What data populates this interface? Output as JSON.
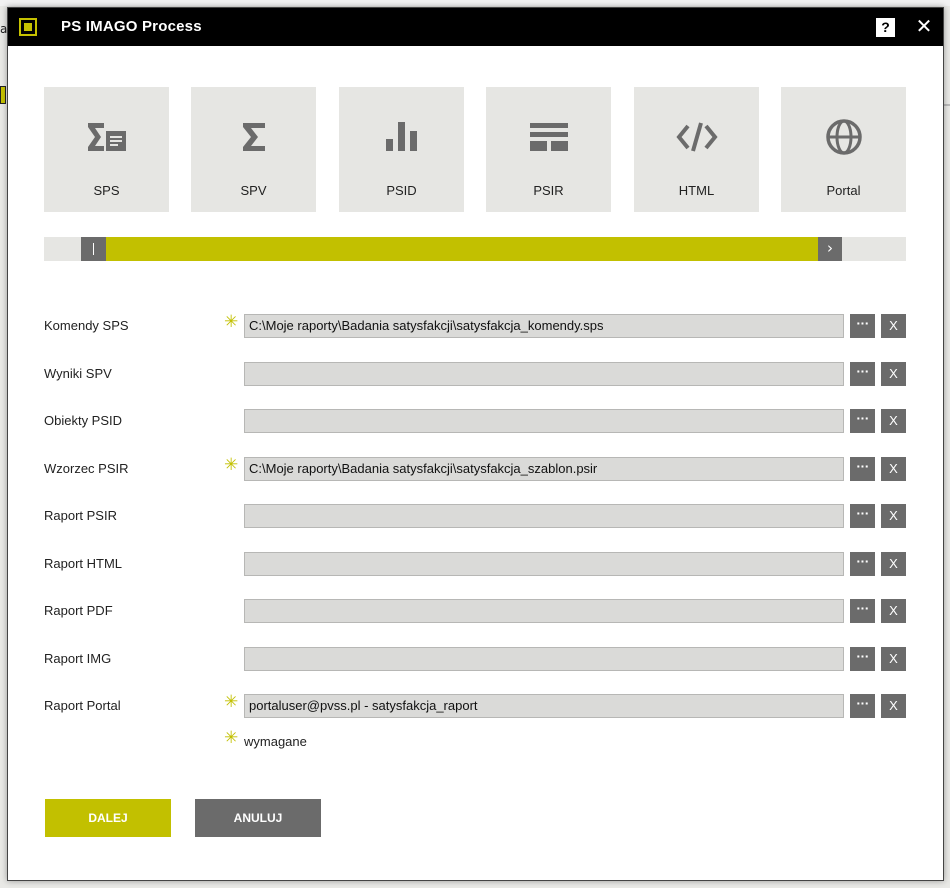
{
  "window": {
    "title": "PS IMAGO Process"
  },
  "background": {
    "fragment_text": "a"
  },
  "tiles": [
    {
      "label": "SPS",
      "icon": "sigma-document-icon"
    },
    {
      "label": "SPV",
      "icon": "sigma-icon"
    },
    {
      "label": "PSID",
      "icon": "bar-chart-icon"
    },
    {
      "label": "PSIR",
      "icon": "layout-grid-icon"
    },
    {
      "label": "HTML",
      "icon": "code-icon"
    },
    {
      "label": "Portal",
      "icon": "globe-icon"
    }
  ],
  "progress": {
    "fraction": 0.89,
    "next_glyph": "›"
  },
  "fields": [
    {
      "label": "Komendy SPS",
      "required": true,
      "value": "C:\\Moje raporty\\Badania satysfakcji\\satysfakcja_komendy.sps"
    },
    {
      "label": "Wyniki SPV",
      "required": false,
      "value": ""
    },
    {
      "label": "Obiekty PSID",
      "required": false,
      "value": ""
    },
    {
      "label": "Wzorzec PSIR",
      "required": true,
      "value": "C:\\Moje raporty\\Badania satysfakcji\\satysfakcja_szablon.psir"
    },
    {
      "label": "Raport PSIR",
      "required": false,
      "value": ""
    },
    {
      "label": "Raport HTML",
      "required": false,
      "value": ""
    },
    {
      "label": "Raport PDF",
      "required": false,
      "value": ""
    },
    {
      "label": "Raport IMG",
      "required": false,
      "value": ""
    },
    {
      "label": "Raport Portal",
      "required": true,
      "value": "portaluser@pvss.pl - satysfakcja_raport"
    }
  ],
  "controls": {
    "required_mark": "✳",
    "browse_label": "···",
    "clear_label": "X",
    "help_label": "?",
    "close_label": "✕"
  },
  "legend": {
    "text": "wymagane"
  },
  "buttons": {
    "next_label": "DALEJ",
    "cancel_label": "ANULUJ"
  },
  "colors": {
    "accent": "#c2c000",
    "button_gray": "#6b6b6b",
    "tile_bg": "#e6e6e3",
    "titlebar": "#000000"
  }
}
